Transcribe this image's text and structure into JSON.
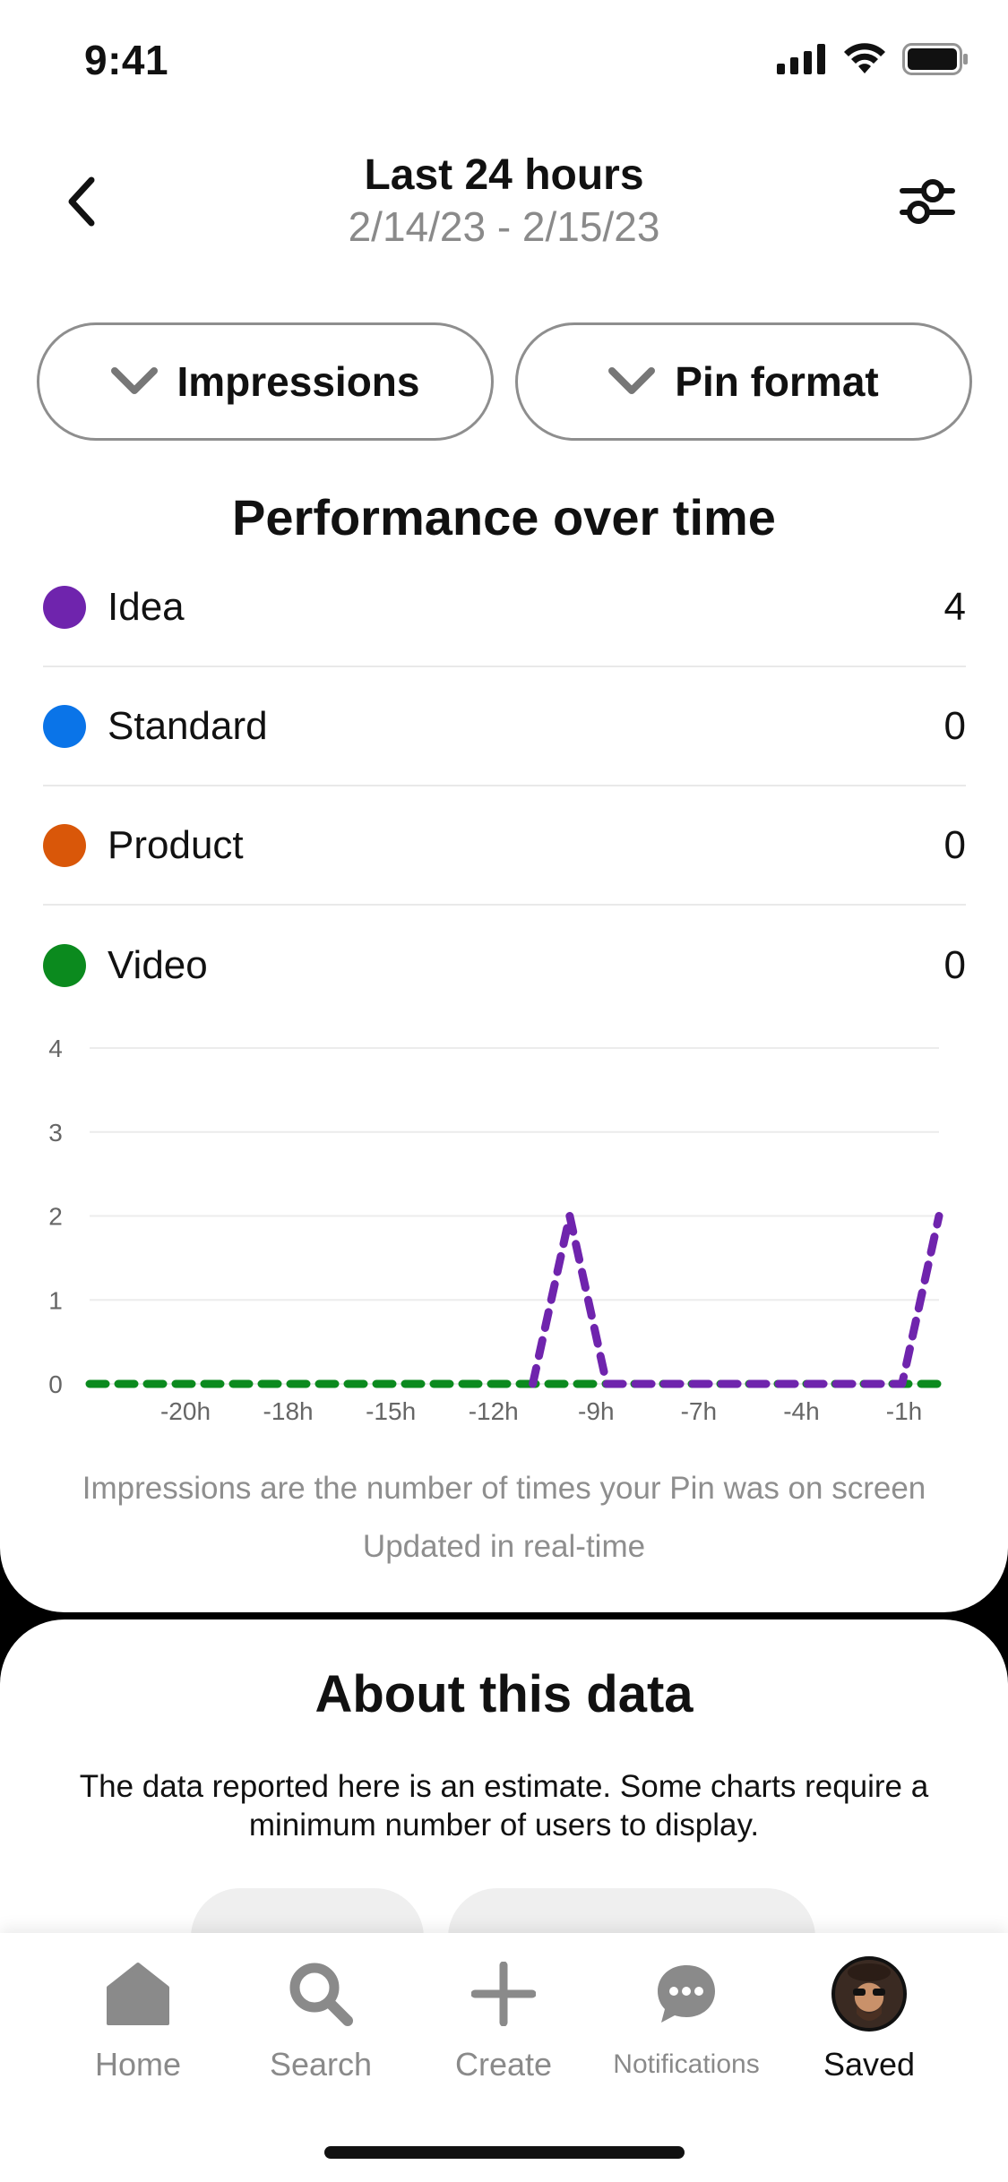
{
  "status_bar": {
    "time": "9:41"
  },
  "header": {
    "title": "Last 24 hours",
    "date_range": "2/14/23 - 2/15/23"
  },
  "dropdowns": {
    "metric": "Impressions",
    "breakdown": "Pin format"
  },
  "section_title": "Performance over time",
  "legend": [
    {
      "label": "Idea",
      "value": "4",
      "color": "#6f24ad"
    },
    {
      "label": "Standard",
      "value": "0",
      "color": "#0a74e8"
    },
    {
      "label": "Product",
      "value": "0",
      "color": "#d95709"
    },
    {
      "label": "Video",
      "value": "0",
      "color": "#0b8a1e"
    }
  ],
  "chart_data": {
    "type": "line",
    "x_tick_labels": [
      "-20h",
      "-18h",
      "-15h",
      "-12h",
      "-9h",
      "-7h",
      "-4h",
      "-1h"
    ],
    "y_tick_labels": [
      "0",
      "1",
      "2",
      "3",
      "4"
    ],
    "ylim": [
      0,
      4
    ],
    "xlim": [
      -23,
      0
    ],
    "grid": true,
    "series": [
      {
        "name": "Video",
        "color": "#0b8a1e",
        "x": [
          -23,
          -11,
          -9,
          0
        ],
        "y": [
          0,
          0,
          0,
          0
        ]
      },
      {
        "name": "Idea",
        "color": "#6f24ad",
        "x": [
          -11,
          -10,
          -9,
          -1,
          0
        ],
        "y": [
          0,
          2,
          0,
          0,
          2
        ]
      }
    ]
  },
  "footnote": "Impressions are the number of times your Pin was on screen",
  "updated": "Updated in real-time",
  "about": {
    "title": "About this data",
    "text": "The data reported here is an estimate. Some charts require a minimum number of users to display."
  },
  "tabs": [
    {
      "label": "Home",
      "icon": "home-icon"
    },
    {
      "label": "Search",
      "icon": "search-icon"
    },
    {
      "label": "Create",
      "icon": "plus-icon"
    },
    {
      "label": "Notifications",
      "icon": "chat-icon"
    },
    {
      "label": "Saved",
      "icon": "avatar"
    }
  ]
}
